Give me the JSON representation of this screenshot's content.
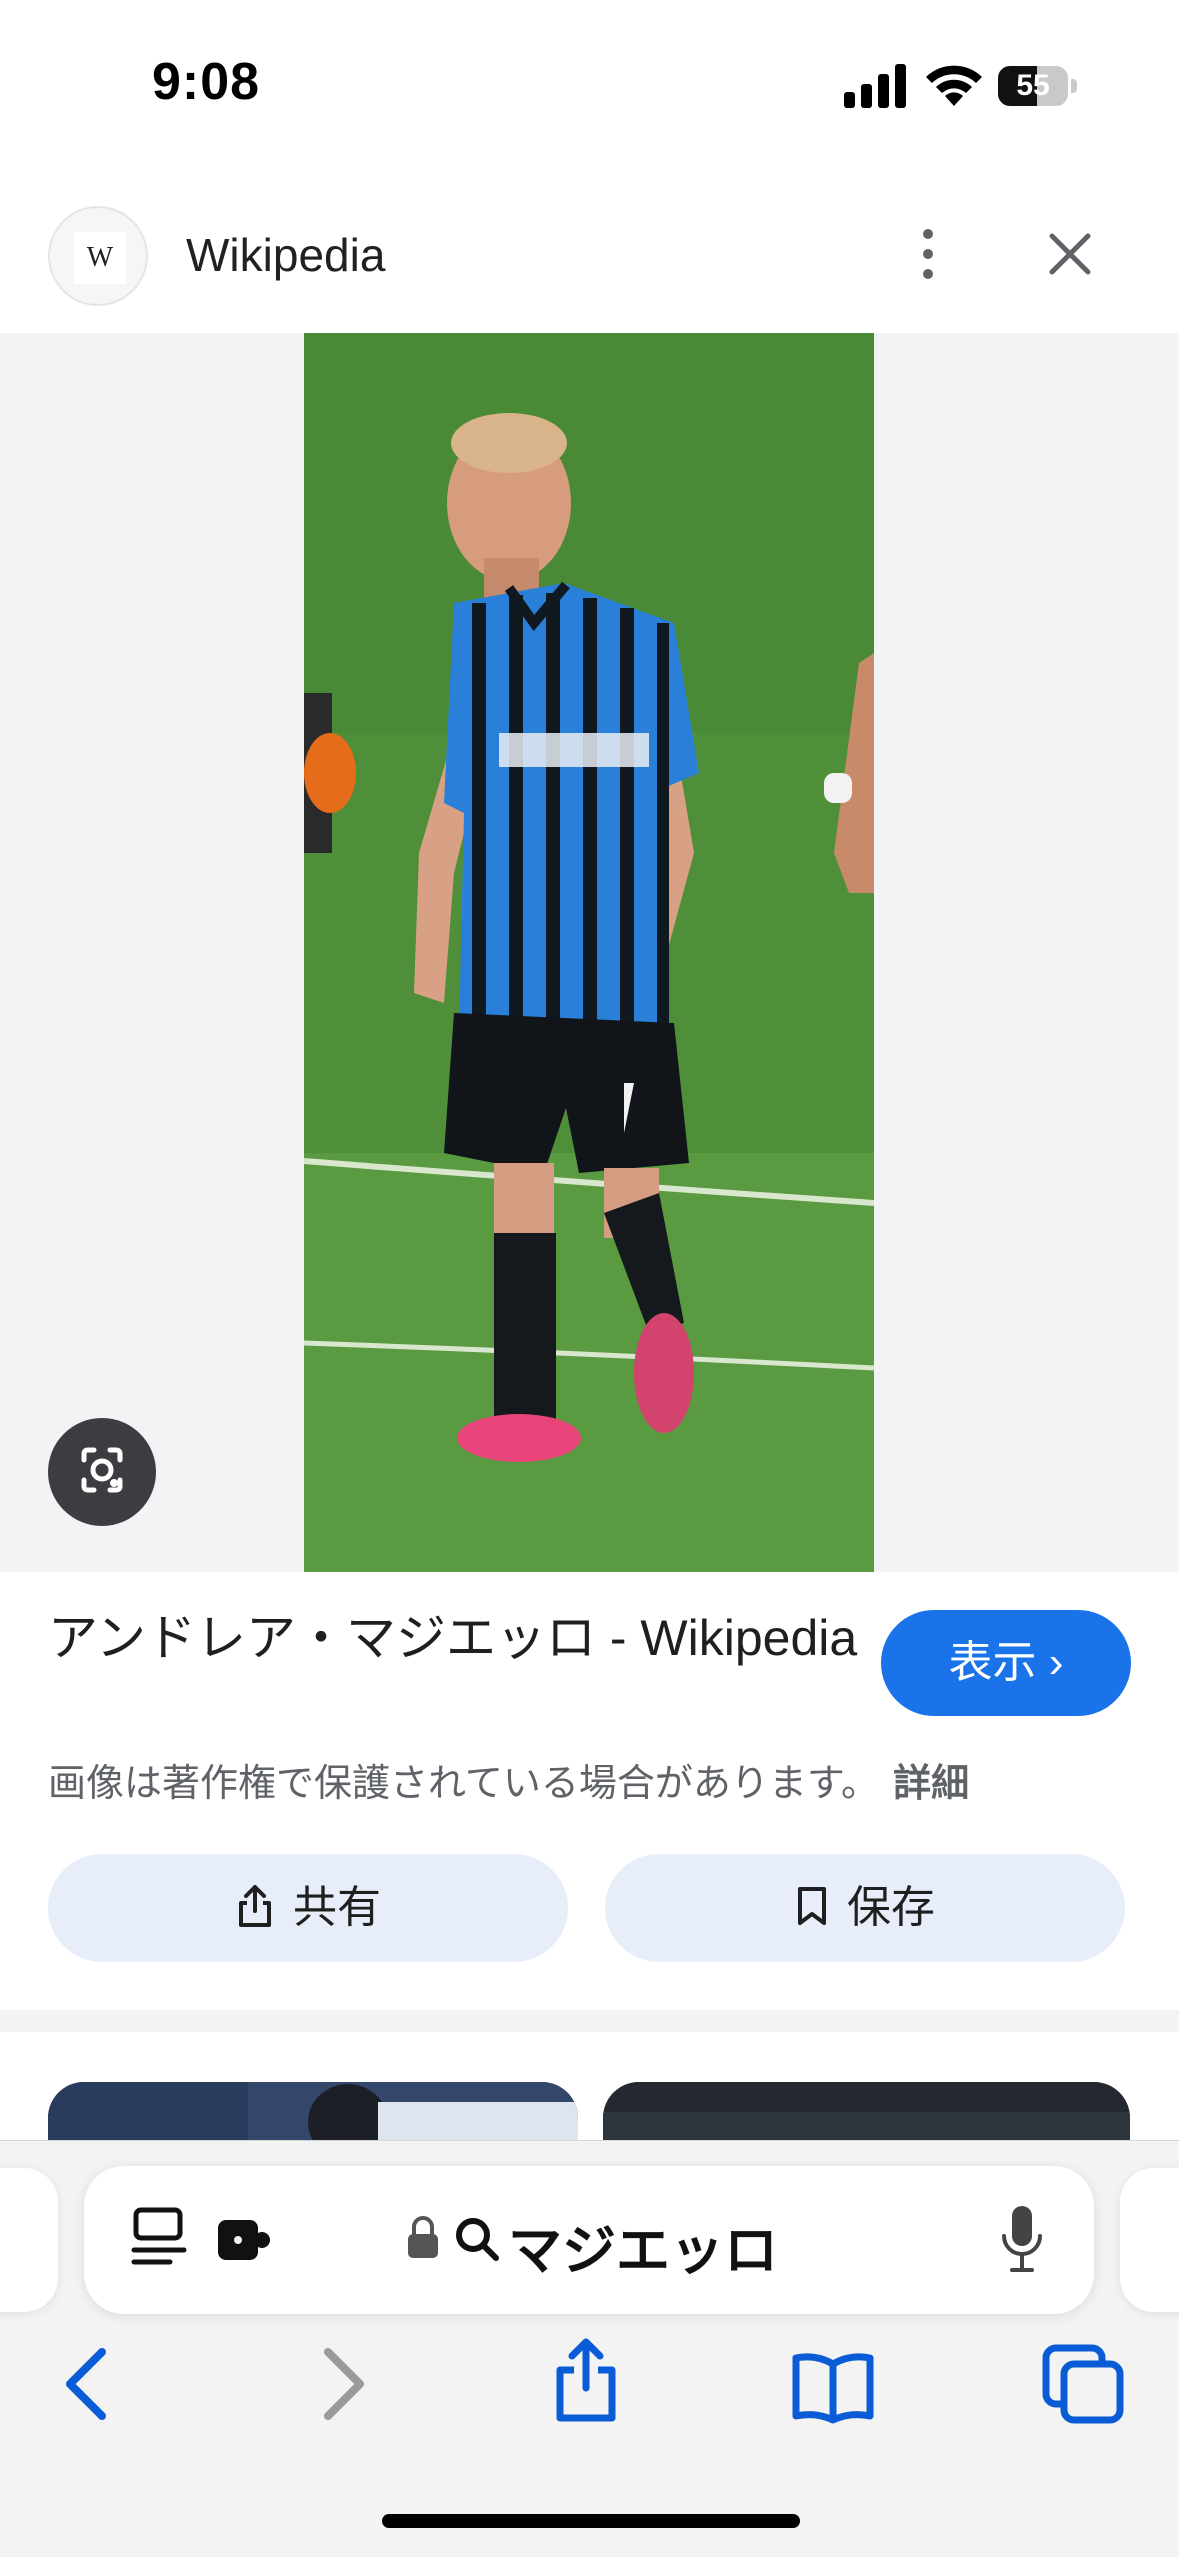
{
  "status_bar": {
    "time": "9:08",
    "battery_percent": "55",
    "battery_level": 0.55
  },
  "header": {
    "site_name": "Wikipedia",
    "logo_letter": "W"
  },
  "image": {
    "icon": "lens-icon"
  },
  "result": {
    "title": "アンドレア・マジエッロ - Wikipedia",
    "visit_label": "表示 ›",
    "copyright_notice": "画像は著作権で保護されている場合があります。",
    "details_label": "詳細"
  },
  "actions": {
    "share_label": "共有",
    "save_label": "保存"
  },
  "browser": {
    "address_text": "マジエッロ"
  },
  "colors": {
    "accent": "#1a73e8",
    "action_bg": "#e8eef9",
    "browser_blue": "#0a5bd6"
  }
}
